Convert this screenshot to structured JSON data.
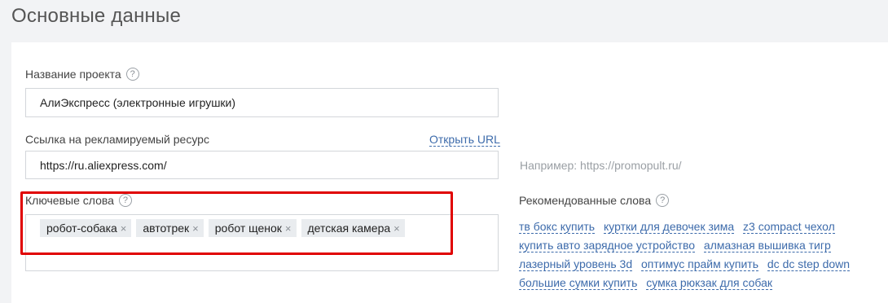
{
  "page": {
    "title": "Основные данные"
  },
  "project_name": {
    "label": "Название проекта",
    "help": "?",
    "value": "АлиЭкспресс (электронные игрушки)"
  },
  "resource_link": {
    "label": "Ссылка на рекламируемый ресурс",
    "open_url_label": "Открыть URL",
    "value": "https://ru.aliexpress.com/",
    "example": "Например: https://promopult.ru/"
  },
  "keywords": {
    "label": "Ключевые слова",
    "help": "?",
    "remove_glyph": "×",
    "tags": [
      "робот-собака",
      "автотрек",
      "робот щенок",
      "детская камера"
    ]
  },
  "recommended": {
    "label": "Рекомендованные слова",
    "help": "?",
    "words": [
      "тв бокс купить",
      "куртки для девочек зима",
      "z3 compact чехол",
      "купить авто зарядное устройство",
      "алмазная вышивка тигр",
      "лазерный уровень 3d",
      "оптимус прайм купить",
      "dc dc step down",
      "большие сумки купить",
      "сумка рюкзак для собак"
    ]
  },
  "colors": {
    "highlight_border": "#e00000",
    "link": "#3d6bab",
    "tag_background": "#e9ecef"
  }
}
